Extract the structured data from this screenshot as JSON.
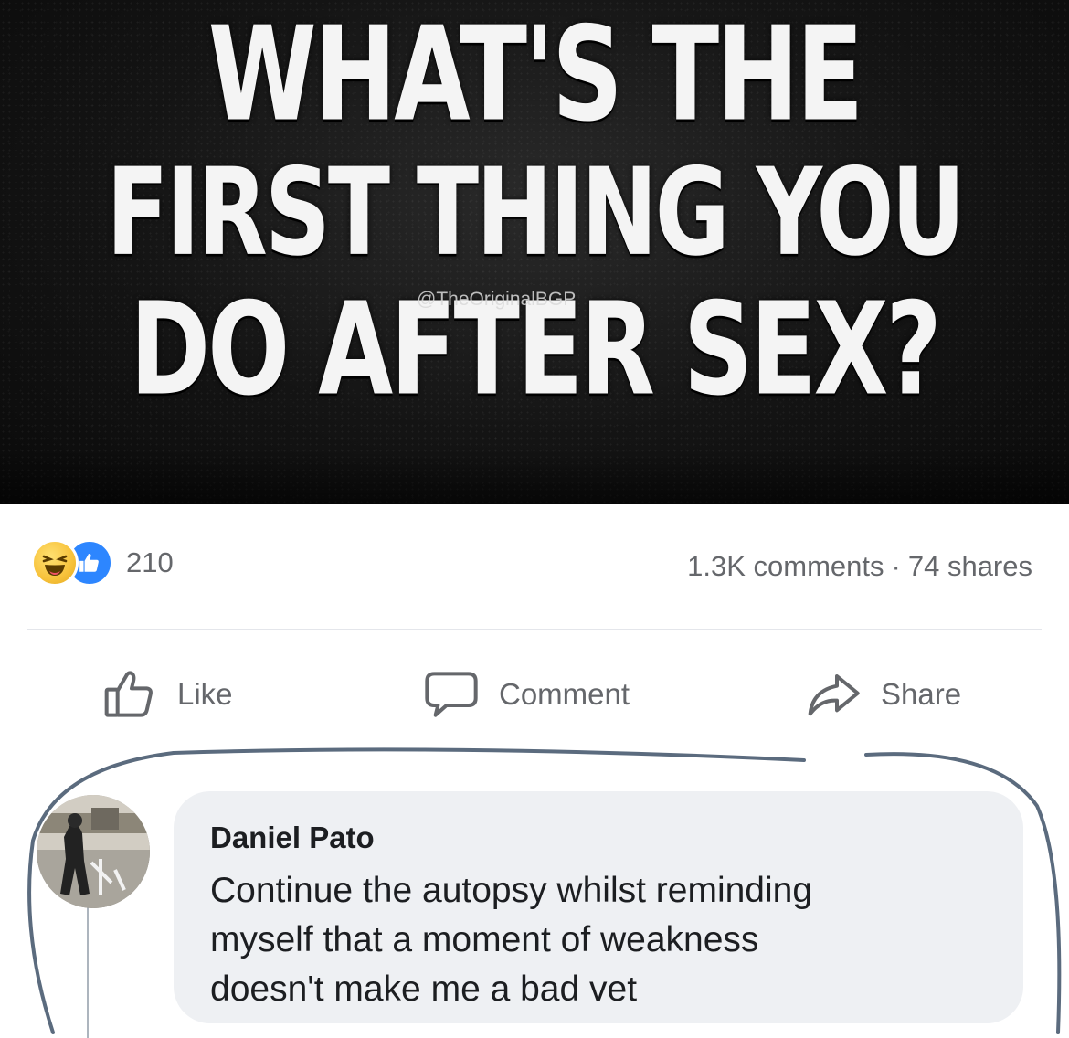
{
  "banner": {
    "headline_lines": [
      "WHAT'S THE",
      "FIRST THING YOU",
      "DO AFTER SEX?"
    ],
    "watermark": "@TheOriginalBGP"
  },
  "post_stats": {
    "reaction_icons": [
      "haha-reaction-icon",
      "like-reaction-icon"
    ],
    "reaction_count": "210",
    "comments": "1.3K comments",
    "separator": "·",
    "shares": "74 shares"
  },
  "actions": {
    "like_label": "Like",
    "comment_label": "Comment",
    "share_label": "Share"
  },
  "comment": {
    "author": "Daniel Pato",
    "text_lines": [
      "Continue the autopsy whilst reminding",
      "myself that a moment of weakness",
      "doesn't make me a bad vet"
    ]
  },
  "colors": {
    "banner_background": "#141414",
    "headline_text": "#f4f4f4",
    "secondary_text": "#65676b",
    "like_blue": "#2d86ff",
    "bubble_background": "#eef0f3",
    "annotation_stroke": "#5b6b7e"
  }
}
